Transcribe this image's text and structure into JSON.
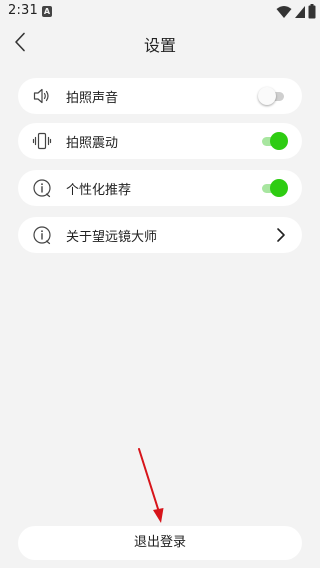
{
  "status_bar": {
    "time": "2:31",
    "notification_letter": "A"
  },
  "header": {
    "title": "设置",
    "back_icon": "chevron-left-icon"
  },
  "settings": [
    {
      "label": "拍照声音",
      "icon": "speaker-icon",
      "control": "toggle",
      "on": false
    },
    {
      "label": "拍照震动",
      "icon": "vibrate-icon",
      "control": "toggle",
      "on": true
    },
    {
      "label": "个性化推荐",
      "icon": "info-icon",
      "control": "toggle",
      "on": true
    },
    {
      "label": "关于望远镜大师",
      "icon": "info-icon",
      "control": "chevron"
    }
  ],
  "logout": {
    "label": "退出登录"
  },
  "colors": {
    "toggle_on": "#2ecc12",
    "toggle_on_track": "#a8e6a0",
    "toggle_off_track": "#cfcfcf",
    "background": "#f3f3f3",
    "annotation_arrow": "#d7141a"
  }
}
